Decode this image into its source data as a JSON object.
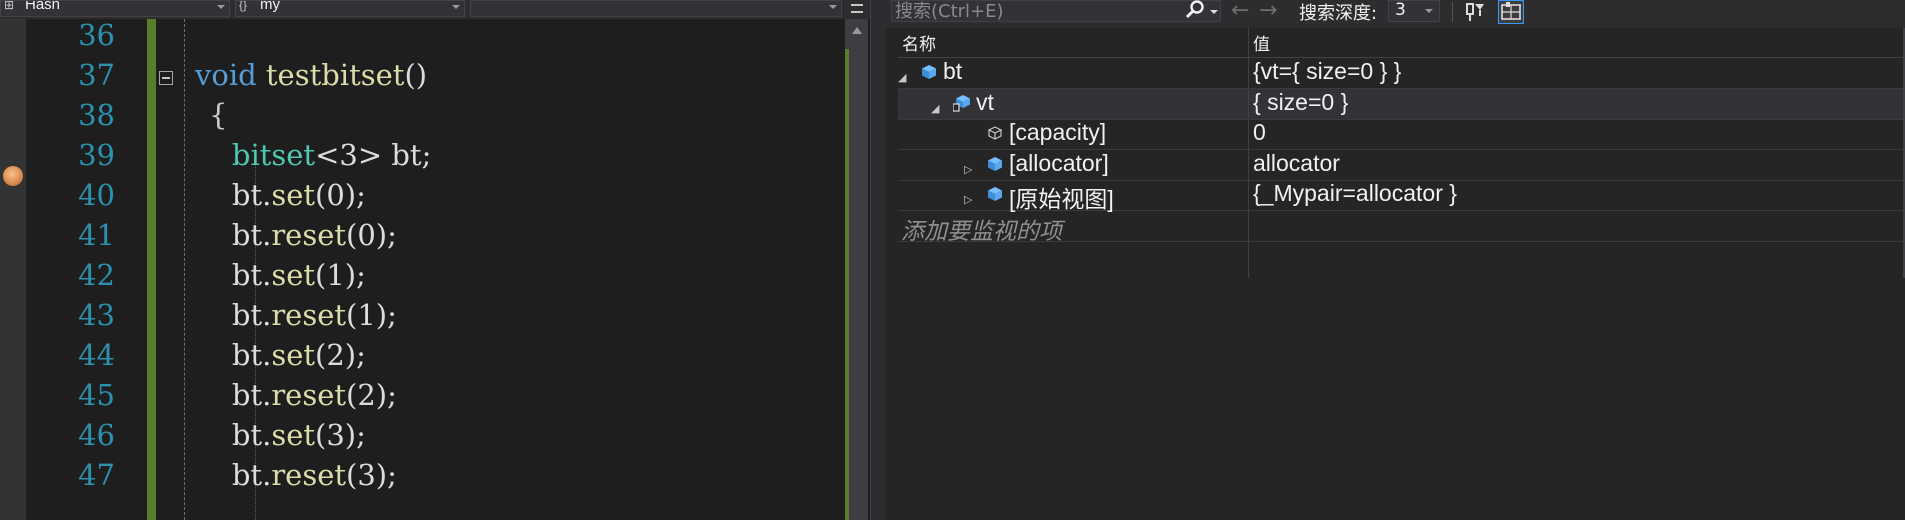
{
  "editor": {
    "nav_combo_left": "Hash",
    "nav_combo_mid": "my",
    "nav_combo_right": "",
    "breakpoint_line": 39,
    "line_numbers": [
      "36",
      "37",
      "38",
      "39",
      "40",
      "41",
      "42",
      "43",
      "44",
      "45",
      "46",
      "47"
    ],
    "code_lines": [
      {
        "tokens": []
      },
      {
        "tokens": [
          {
            "t": "void",
            "c": "kw"
          },
          {
            "t": " ",
            "c": ""
          },
          {
            "t": "testbitset",
            "c": "fn"
          },
          {
            "t": "()",
            "c": ""
          }
        ]
      },
      {
        "tokens": [
          {
            "t": "{",
            "c": "br"
          }
        ]
      },
      {
        "tokens": [
          {
            "t": "    ",
            "c": ""
          },
          {
            "t": "bitset",
            "c": "ty"
          },
          {
            "t": "<3> bt;",
            "c": ""
          }
        ]
      },
      {
        "tokens": [
          {
            "t": "    bt.",
            "c": ""
          },
          {
            "t": "set",
            "c": "fn"
          },
          {
            "t": "(0);",
            "c": ""
          }
        ]
      },
      {
        "tokens": [
          {
            "t": "    bt.",
            "c": ""
          },
          {
            "t": "reset",
            "c": "fn"
          },
          {
            "t": "(0);",
            "c": ""
          }
        ]
      },
      {
        "tokens": [
          {
            "t": "    bt.",
            "c": ""
          },
          {
            "t": "set",
            "c": "fn"
          },
          {
            "t": "(1);",
            "c": ""
          }
        ]
      },
      {
        "tokens": [
          {
            "t": "    bt.",
            "c": ""
          },
          {
            "t": "reset",
            "c": "fn"
          },
          {
            "t": "(1);",
            "c": ""
          }
        ]
      },
      {
        "tokens": [
          {
            "t": "    bt.",
            "c": ""
          },
          {
            "t": "set",
            "c": "fn"
          },
          {
            "t": "(2);",
            "c": ""
          }
        ]
      },
      {
        "tokens": [
          {
            "t": "    bt.",
            "c": ""
          },
          {
            "t": "reset",
            "c": "fn"
          },
          {
            "t": "(2);",
            "c": ""
          }
        ]
      },
      {
        "tokens": [
          {
            "t": "    bt.",
            "c": ""
          },
          {
            "t": "set",
            "c": "fn"
          },
          {
            "t": "(3);",
            "c": ""
          }
        ]
      },
      {
        "tokens": [
          {
            "t": "    bt.",
            "c": ""
          },
          {
            "t": "reset",
            "c": "fn"
          },
          {
            "t": "(3);",
            "c": ""
          }
        ]
      }
    ]
  },
  "watch": {
    "search_placeholder": "搜索(Ctrl+E)",
    "search_depth_label": "搜索深度:",
    "search_depth_value": "3",
    "columns": {
      "name": "名称",
      "value": "值"
    },
    "rows": [
      {
        "name": "bt",
        "value": "{vt={ size=0 } }",
        "expander": "expanded",
        "icon": "field-icon",
        "depth": 0
      },
      {
        "name": "vt",
        "value": "{ size=0 }",
        "expander": "expanded",
        "icon": "protected-field-icon",
        "depth": 1
      },
      {
        "name": "[capacity]",
        "value": "0",
        "expander": "none",
        "icon": "property-icon",
        "depth": 2
      },
      {
        "name": "[allocator]",
        "value": "allocator",
        "expander": "collapsed",
        "icon": "field-icon",
        "depth": 2
      },
      {
        "name": "[原始视图]",
        "value": "{_Mypair=allocator }",
        "expander": "collapsed",
        "icon": "field-icon",
        "depth": 2
      }
    ],
    "add_item_placeholder": "添加要监视的项"
  },
  "colors": {
    "line_number": "#2b91af",
    "keyword": "#569cd6",
    "function": "#dcdcaa",
    "type": "#4ec9b0",
    "change_bar": "#5a7d2b"
  }
}
